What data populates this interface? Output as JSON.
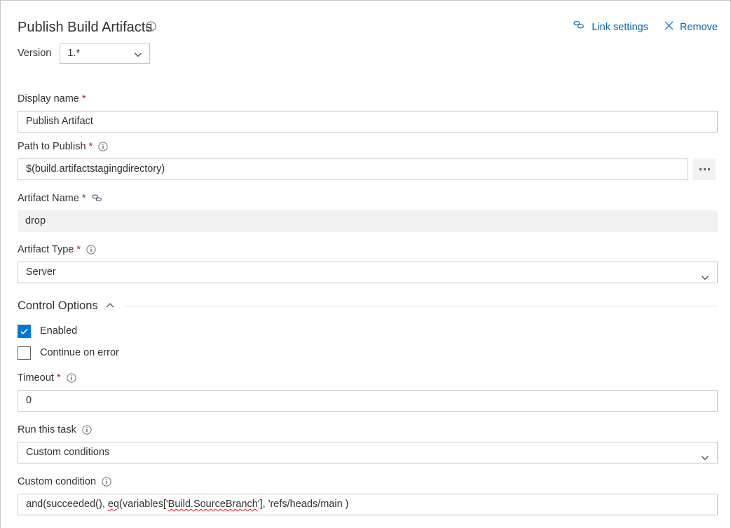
{
  "header": {
    "title": "Publish Build Artifacts",
    "title_info_icon": "info-icon",
    "link_settings_label": "Link settings",
    "link_settings_icon": "link-icon",
    "remove_label": "Remove",
    "remove_icon": "close-icon"
  },
  "version": {
    "label": "Version",
    "value": "1.*",
    "chevron_icon": "chevron-down-icon"
  },
  "fields": {
    "display_name": {
      "label": "Display name",
      "required_marker": "*",
      "value": "Publish Artifact"
    },
    "path_to_publish": {
      "label": "Path to Publish",
      "required_marker": "*",
      "info_icon": "info-icon",
      "value": "$(build.artifactstagingdirectory)",
      "browse_button_icon": "ellipsis-icon"
    },
    "artifact_name": {
      "label": "Artifact Name",
      "required_marker": "*",
      "link_icon": "link-icon",
      "value": "drop",
      "readonly": true
    },
    "artifact_type": {
      "label": "Artifact Type",
      "required_marker": "*",
      "info_icon": "info-icon",
      "value": "Server",
      "chevron_icon": "chevron-down-icon"
    }
  },
  "control_options": {
    "section_title": "Control Options",
    "collapse_icon": "chevron-up-icon",
    "enabled": {
      "label": "Enabled",
      "checked": true
    },
    "continue_on_error": {
      "label": "Continue on error",
      "checked": false
    },
    "timeout": {
      "label": "Timeout",
      "required_marker": "*",
      "info_icon": "info-icon",
      "value": "0"
    },
    "run_this_task": {
      "label": "Run this task",
      "info_icon": "info-icon",
      "value": "Custom conditions",
      "chevron_icon": "chevron-down-icon"
    },
    "custom_condition": {
      "label": "Custom condition",
      "info_icon": "info-icon",
      "value_prefix": "and(succeeded(), ",
      "value_misspelled_1": "eq",
      "value_mid": "(variables['",
      "value_misspelled_2": "Build.SourceBranch",
      "value_suffix": "'], 'refs/heads/main )",
      "value": "and(succeeded(), eq(variables['Build.SourceBranch'], 'refs/heads/main )"
    }
  },
  "colors": {
    "accent": "#0078d4",
    "link": "#0065b3",
    "required": "#a4262c",
    "border": "#c8c6c4",
    "readonly_bg": "#f3f2f1",
    "text": "#323130",
    "spellcheck": "#e81123"
  }
}
